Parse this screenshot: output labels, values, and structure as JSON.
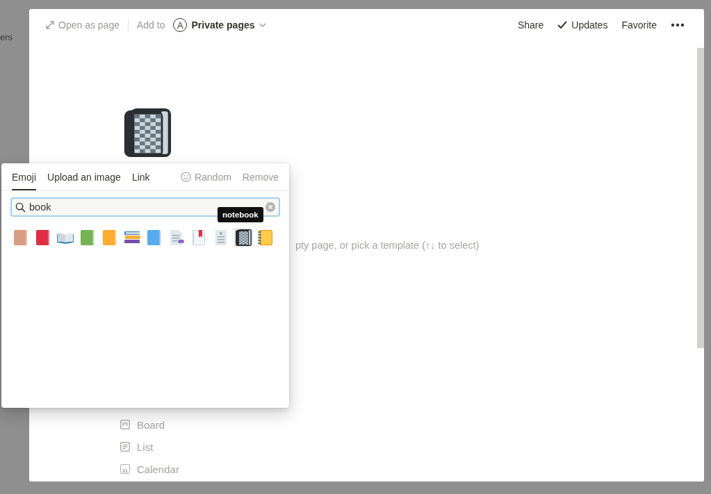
{
  "backdrop_text": "ers",
  "header": {
    "open_as_page": "Open as page",
    "add_to": "Add to",
    "workspace_initial": "A",
    "workspace": "Private pages",
    "actions": [
      {
        "label": "Share",
        "kind": "text"
      },
      {
        "label": "Updates",
        "kind": "check"
      },
      {
        "label": "Favorite",
        "kind": "text"
      }
    ]
  },
  "page": {
    "hint": "pty page, or pick a template (↑↓ to select)",
    "views": [
      {
        "label": "Board",
        "kind": "board"
      },
      {
        "label": "List",
        "kind": "list"
      },
      {
        "label": "Calendar",
        "kind": "calendar",
        "icon_text": "31"
      }
    ]
  },
  "emoji_picker": {
    "tabs": [
      {
        "label": "Emoji",
        "selected": true
      },
      {
        "label": "Upload an image",
        "selected": false
      },
      {
        "label": "Link",
        "selected": false
      }
    ],
    "random": "Random",
    "remove": "Remove",
    "search": {
      "value": "book"
    },
    "tooltip": "notebook",
    "results": [
      {
        "kind": "book",
        "color": "#d99e82",
        "selected": false
      },
      {
        "kind": "book",
        "color": "#dd2e44",
        "selected": false
      },
      {
        "kind": "open-book",
        "selected": false
      },
      {
        "kind": "book",
        "color": "#77b255",
        "selected": false
      },
      {
        "kind": "book",
        "color": "#ffac33",
        "selected": false
      },
      {
        "kind": "books",
        "selected": false
      },
      {
        "kind": "book",
        "color": "#55acee",
        "selected": false
      },
      {
        "kind": "document",
        "selected": false
      },
      {
        "kind": "bookmark",
        "selected": false
      },
      {
        "kind": "newspaper",
        "selected": false
      },
      {
        "kind": "notebook",
        "selected": true
      },
      {
        "kind": "spiral",
        "selected": false
      }
    ]
  }
}
